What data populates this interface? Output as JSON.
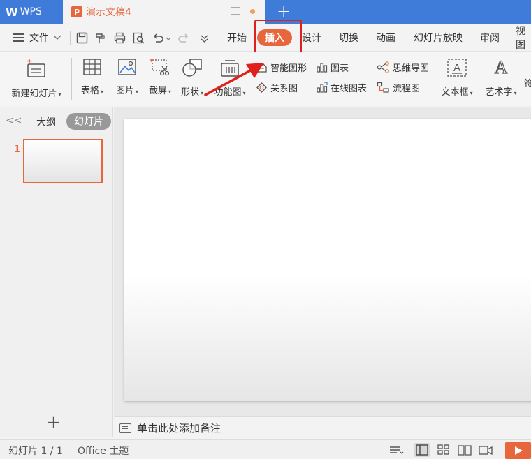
{
  "titlebar": {
    "app_name": "WPS",
    "logo_glyph": "W",
    "doc_tab": {
      "icon_letter": "P",
      "title": "演示文稿4"
    },
    "new_tab_glyph": "+"
  },
  "menubar": {
    "file_label": "文件",
    "tabs": [
      {
        "label": "开始"
      },
      {
        "label": "插入",
        "active": true
      },
      {
        "label": "设计"
      },
      {
        "label": "切换"
      },
      {
        "label": "动画"
      },
      {
        "label": "幻灯片放映"
      },
      {
        "label": "审阅"
      },
      {
        "label": "视图"
      }
    ]
  },
  "ribbon": {
    "new_slide": "新建幻灯片",
    "table": "表格",
    "picture": "图片",
    "screenshot": "截屏",
    "shape": "形状",
    "function_chart": "功能图",
    "smart_art": "智能图形",
    "chart": "图表",
    "mind_map": "思维导图",
    "relation_chart": "关系图",
    "online_chart": "在线图表",
    "flowchart": "流程图",
    "text_box": "文本框",
    "word_art": "艺术字",
    "textbox_glyph": "A",
    "wordart_glyph": "A"
  },
  "leftpanel": {
    "outline_tab": "大纲",
    "slides_tab": "幻灯片",
    "slide_number": "1",
    "collapse_glyph": "<<",
    "add_glyph": "+"
  },
  "notes": {
    "placeholder": "单击此处添加备注"
  },
  "statusbar": {
    "slide_info": "幻灯片 1 / 1",
    "theme": "Office 主题"
  },
  "colors": {
    "accent": "#e8663c",
    "titlebar": "#3f7cd9",
    "highlight_box": "#e0201a"
  }
}
